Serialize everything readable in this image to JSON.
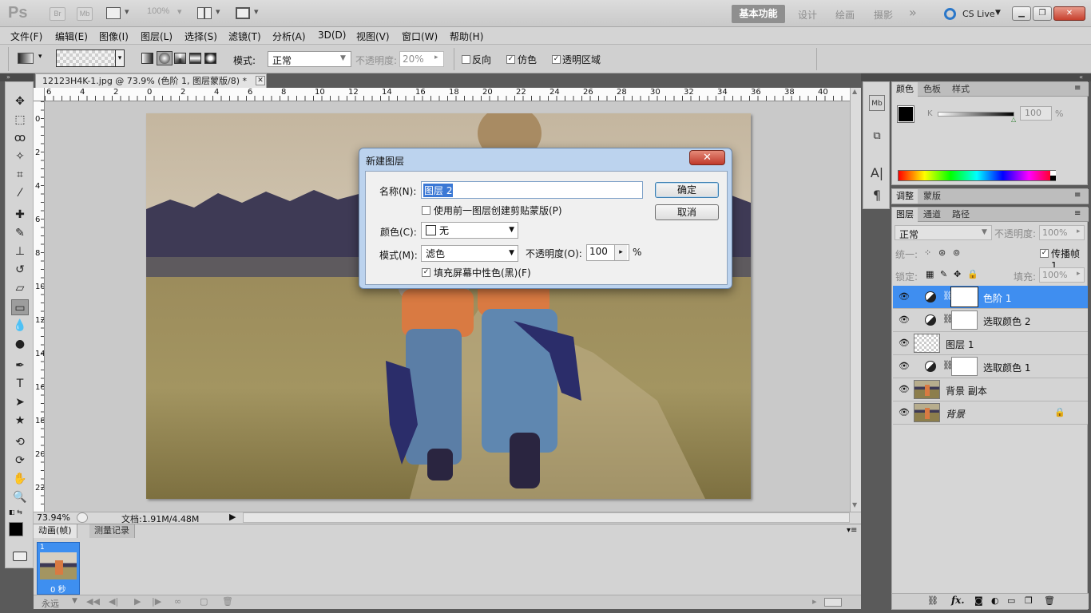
{
  "app": {
    "logo": "Ps",
    "launch_bridge": "Br",
    "mini_bridge": "Mb",
    "zoom": "100%",
    "workspaces": [
      "基本功能",
      "设计",
      "绘画",
      "摄影"
    ],
    "workspace_more": "»",
    "cs_live": "CS Live"
  },
  "menu": [
    "文件(F)",
    "编辑(E)",
    "图像(I)",
    "图层(L)",
    "选择(S)",
    "滤镜(T)",
    "分析(A)",
    "3D(D)",
    "视图(V)",
    "窗口(W)",
    "帮助(H)"
  ],
  "options": {
    "mode_label": "模式:",
    "mode_value": "正常",
    "opacity_label": "不透明度:",
    "opacity_value": "20%",
    "reverse_label": "反向",
    "dither_label": "仿色",
    "transparency_label": "透明区域"
  },
  "document": {
    "tab_title": "12123H4K-1.jpg @ 73.9% (色阶 1, 图层蒙版/8) *",
    "zoom": "73.94%",
    "doc_info": "文档:1.91M/4.48M",
    "ruler_h": [
      "6",
      "4",
      "2",
      "0",
      "2",
      "4",
      "6",
      "8",
      "10",
      "12",
      "14",
      "16",
      "18",
      "20",
      "22",
      "24",
      "26",
      "28",
      "30",
      "32",
      "34",
      "36",
      "38",
      "40"
    ],
    "ruler_v": [
      "0",
      "2",
      "4",
      "6",
      "8",
      "10",
      "12",
      "14",
      "16",
      "18",
      "20",
      "22"
    ]
  },
  "animation_panel": {
    "tabs": [
      "动画(帧)",
      "测量记录"
    ],
    "frame_number": "1",
    "frame_delay": "0 秒",
    "loop": "永远"
  },
  "color_panel": {
    "tabs": [
      "颜色",
      "色板",
      "样式"
    ],
    "k_label": "K",
    "k_value": "100",
    "k_unit": "%"
  },
  "adjust_panel": {
    "tabs": [
      "调整",
      "蒙版"
    ]
  },
  "layers_panel": {
    "tabs": [
      "图层",
      "通道",
      "路径"
    ],
    "blend_mode": "正常",
    "opacity_label": "不透明度:",
    "opacity_value": "100%",
    "unify_label": "统一:",
    "propagate_label": "传播帧 1",
    "lock_label": "锁定:",
    "fill_label": "填充:",
    "fill_value": "100%",
    "layers": [
      {
        "name": "色阶 1",
        "type": "adjustment",
        "selected": true
      },
      {
        "name": "选取颜色 2",
        "type": "adjustment",
        "selected": false
      },
      {
        "name": "图层 1",
        "type": "transparent",
        "selected": false
      },
      {
        "name": "选取颜色 1",
        "type": "adjustment",
        "selected": false
      },
      {
        "name": "背景 副本",
        "type": "photo",
        "selected": false
      },
      {
        "name": "背景",
        "type": "photo-locked",
        "selected": false
      }
    ],
    "footer_fx": "fx."
  },
  "dialog": {
    "title": "新建图层",
    "name_label": "名称(N):",
    "name_value": "图层 2",
    "clip_label": "使用前一图层创建剪贴蒙版(P)",
    "color_label": "颜色(C):",
    "color_value": "无",
    "mode_label": "模式(M):",
    "mode_value": "滤色",
    "opacity_label": "不透明度(O):",
    "opacity_value": "100",
    "opacity_unit": "%",
    "fill_label": "填充屏幕中性色(黑)(F)",
    "fill_checked": true,
    "ok": "确定",
    "cancel": "取消"
  }
}
